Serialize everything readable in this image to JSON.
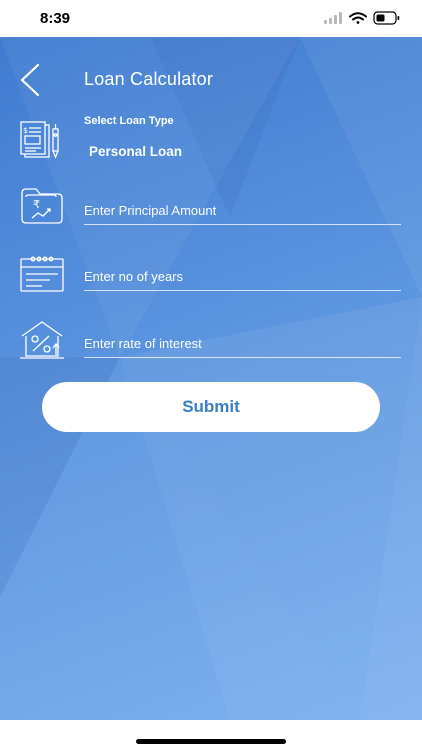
{
  "status_bar": {
    "time": "8:39",
    "icons": [
      "signal-icon",
      "wifi-icon",
      "battery-icon"
    ]
  },
  "header": {
    "title": "Loan Calculator",
    "back_icon": "chevron-left-icon"
  },
  "form": {
    "loan_type": {
      "label": "Select Loan Type",
      "value": "Personal Loan",
      "icon": "document-pen-icon"
    },
    "principal": {
      "placeholder": "Enter Principal Amount",
      "icon": "rupee-folder-icon"
    },
    "years": {
      "placeholder": "Enter no of years",
      "icon": "calendar-icon"
    },
    "rate": {
      "placeholder": "Enter rate of interest",
      "icon": "house-percent-icon"
    },
    "submit_label": "Submit"
  },
  "colors": {
    "background_top": "#3f7bd0",
    "background_bottom": "#79aef0",
    "accent_text": "#3b7dc6",
    "foreground": "#ffffff"
  }
}
